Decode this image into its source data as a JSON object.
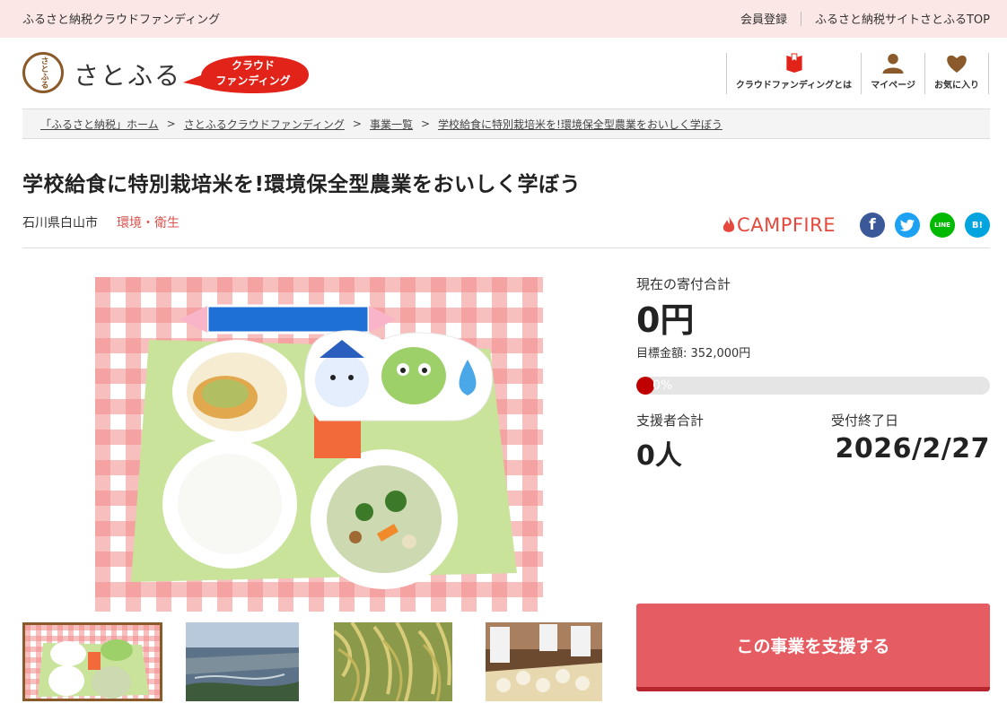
{
  "topbar": {
    "site_name": "ふるさと納税クラウドファンディング",
    "links": [
      "会員登録",
      "ふるさと納税サイトさとふるTOP"
    ]
  },
  "header": {
    "logo_mark": "さとふる",
    "logo_text": "さとふる",
    "badge_line1": "クラウド",
    "badge_line2": "ファンディング",
    "nav": [
      {
        "label": "クラウドファンディングとは",
        "icon": "book-icon"
      },
      {
        "label": "マイページ",
        "icon": "person-icon"
      },
      {
        "label": "お気に入り",
        "icon": "heart-icon"
      }
    ]
  },
  "breadcrumb": [
    "「ふるさと納税」ホーム",
    "さとふるクラウドファンディング",
    "事業一覧",
    "学校給食に特別栽培米を!環境保全型農業をおいしく学ぼう"
  ],
  "breadcrumb_separator": ">",
  "project": {
    "title": "学校給食に特別栽培米を!環境保全型農業をおいしく学ぼう",
    "prefecture": "石川県白山市",
    "category": "環境・衛生"
  },
  "share": {
    "campfire": "CAMPFIRE",
    "facebook": "f",
    "line": "LINE",
    "hatena": "B!"
  },
  "stats": {
    "current_label": "現在の寄付合計",
    "current_amount": "0円",
    "goal": "目標金額: 352,000円",
    "progress_percent": 0,
    "progress_text": "0%",
    "supporters_label": "支援者合計",
    "supporters": "0人",
    "deadline_label": "受付終了日",
    "deadline": "2026/2/27"
  },
  "support_button": "この事業を支援する",
  "colors": {
    "topbar_bg": "#fbe7e5",
    "accent_red": "#e55c63",
    "progress_fill": "#c00000",
    "category": "#d9534f",
    "campfire": "#e6483d"
  }
}
